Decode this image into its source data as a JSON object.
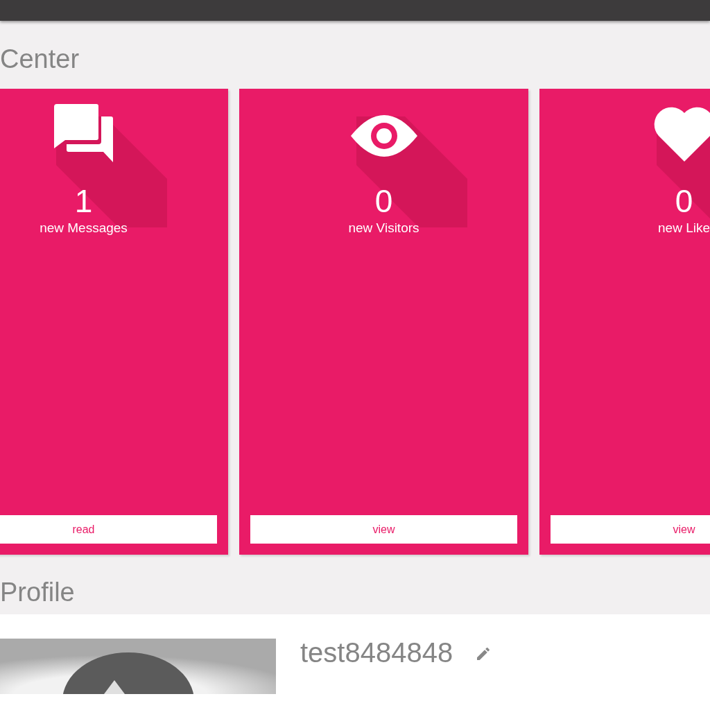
{
  "sections": [
    {
      "title": "Center"
    },
    {
      "title": "Profile"
    }
  ],
  "cards": [
    {
      "kind": "messages",
      "count": "1",
      "label": "new Messages",
      "action": "read"
    },
    {
      "kind": "visitors",
      "count": "0",
      "label": "new Visitors",
      "action": "view"
    },
    {
      "kind": "likes",
      "count": "0",
      "label": "new Like",
      "action": "view"
    }
  ],
  "profile": {
    "username": "test8484848"
  }
}
